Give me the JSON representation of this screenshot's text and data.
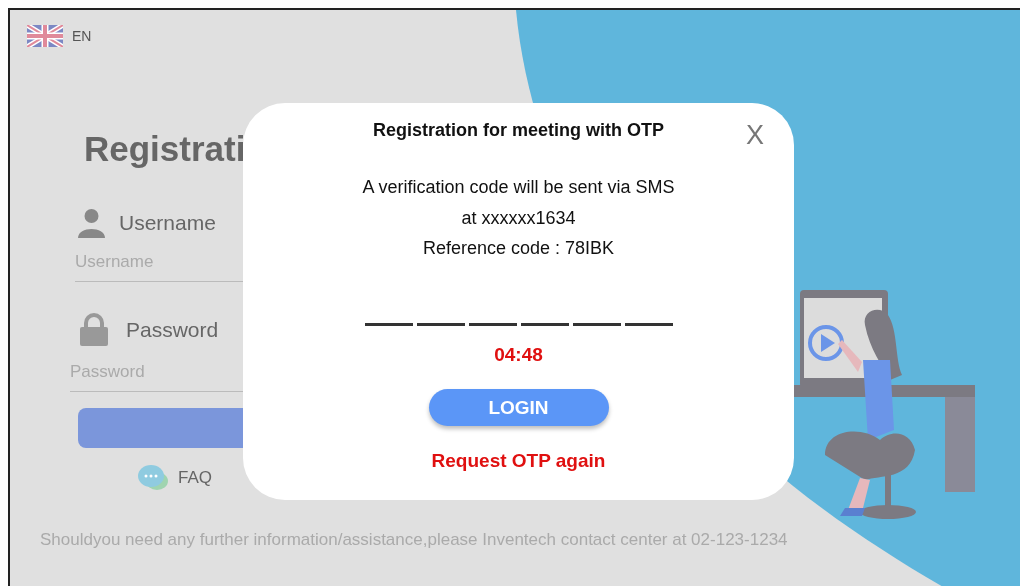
{
  "language": {
    "label": "EN"
  },
  "form": {
    "title": "Registrati",
    "username": {
      "label": "Username",
      "placeholder": "Username"
    },
    "password": {
      "label": "Password",
      "placeholder": "Password"
    },
    "faq": "FAQ"
  },
  "footer": "Shouldyou need any further information/assistance,please Inventech contact center at 02-123-1234",
  "dialog": {
    "title": "Registration for meeting with OTP",
    "close": "X",
    "lines": [
      "A verification code will be sent via SMS",
      "at xxxxxx1634",
      "Reference code : 78IBK"
    ],
    "otp_slots": [
      {
        "filled": false
      },
      {
        "filled": false
      },
      {
        "filled": false
      },
      {
        "filled": false
      },
      {
        "filled": false
      },
      {
        "filled": false
      }
    ],
    "timer": "04:48",
    "button": "LOGIN",
    "link": "Request OTP again"
  }
}
